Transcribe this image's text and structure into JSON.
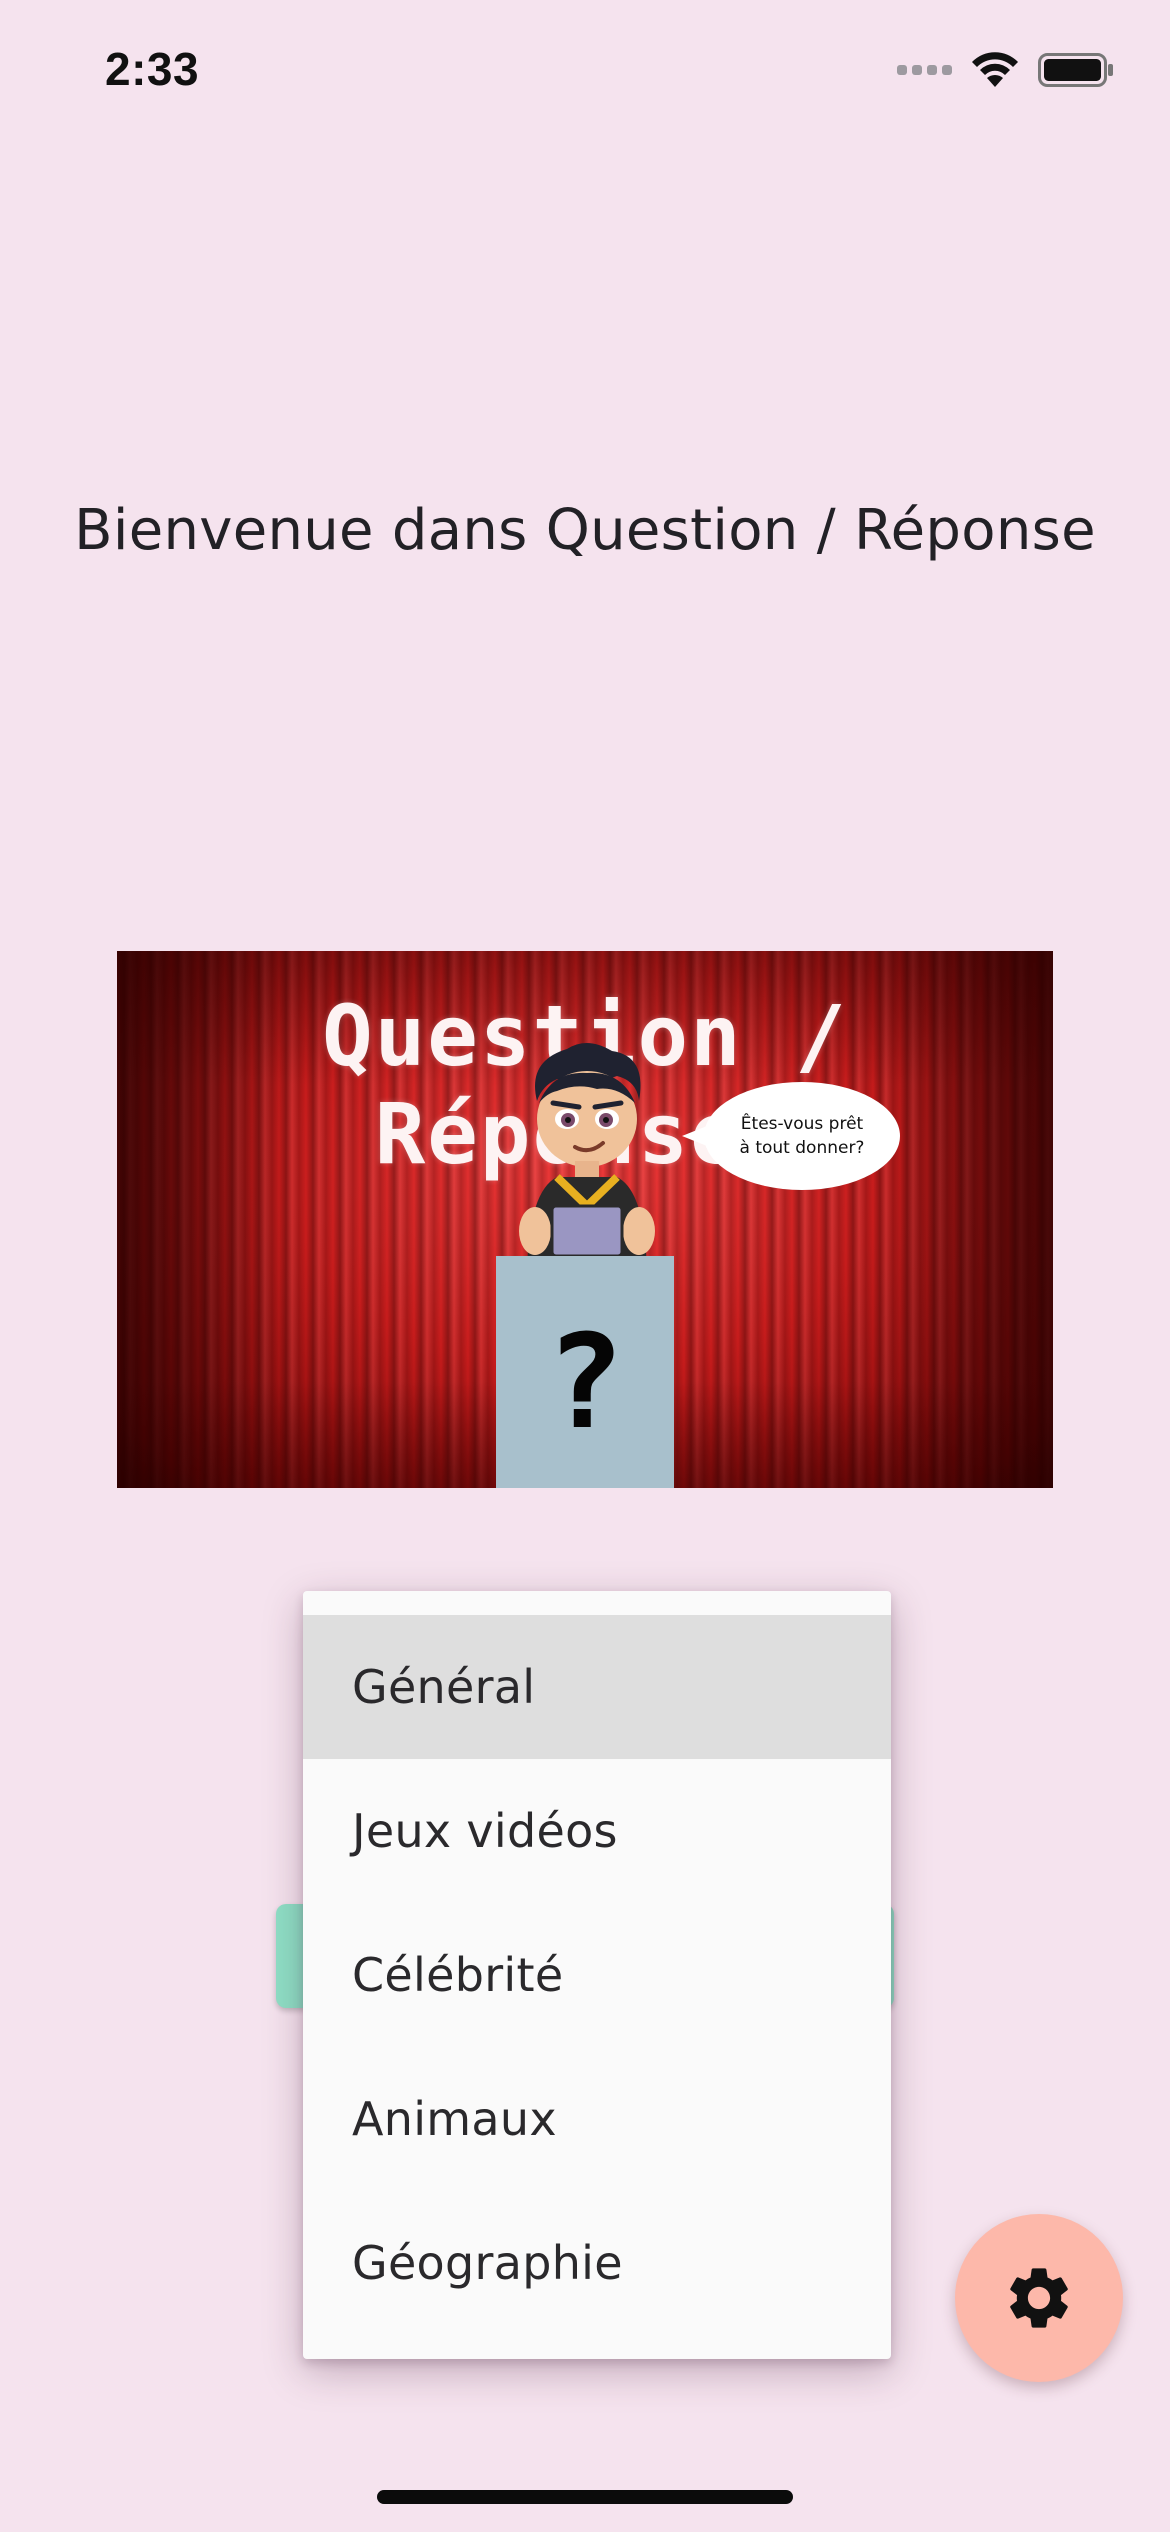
{
  "status_bar": {
    "time": "2:33",
    "icons": [
      "cellular-signal-icon",
      "wifi-icon",
      "battery-icon"
    ]
  },
  "header": {
    "title": "Bienvenue dans Question / Réponse"
  },
  "banner": {
    "title": "Question / Réponses",
    "speech_line1": "Êtes-vous prêt",
    "speech_line2": "à tout donner?",
    "podium_mark": "?"
  },
  "category_menu": {
    "selected": "Général",
    "items": [
      {
        "label": "Général",
        "selected": true
      },
      {
        "label": "Jeux vidéos",
        "selected": false
      },
      {
        "label": "Célébrité",
        "selected": false
      },
      {
        "label": "Animaux",
        "selected": false
      },
      {
        "label": "Géographie",
        "selected": false
      }
    ]
  },
  "fab": {
    "icon": "gear-icon"
  },
  "colors": {
    "background": "#f5e3ee",
    "fab": "#fdb8aa",
    "button_accent": "#8fe0c6",
    "menu_selected": "#dedede",
    "curtain_red": "#c81c1c",
    "podium": "#a8c0cc"
  }
}
